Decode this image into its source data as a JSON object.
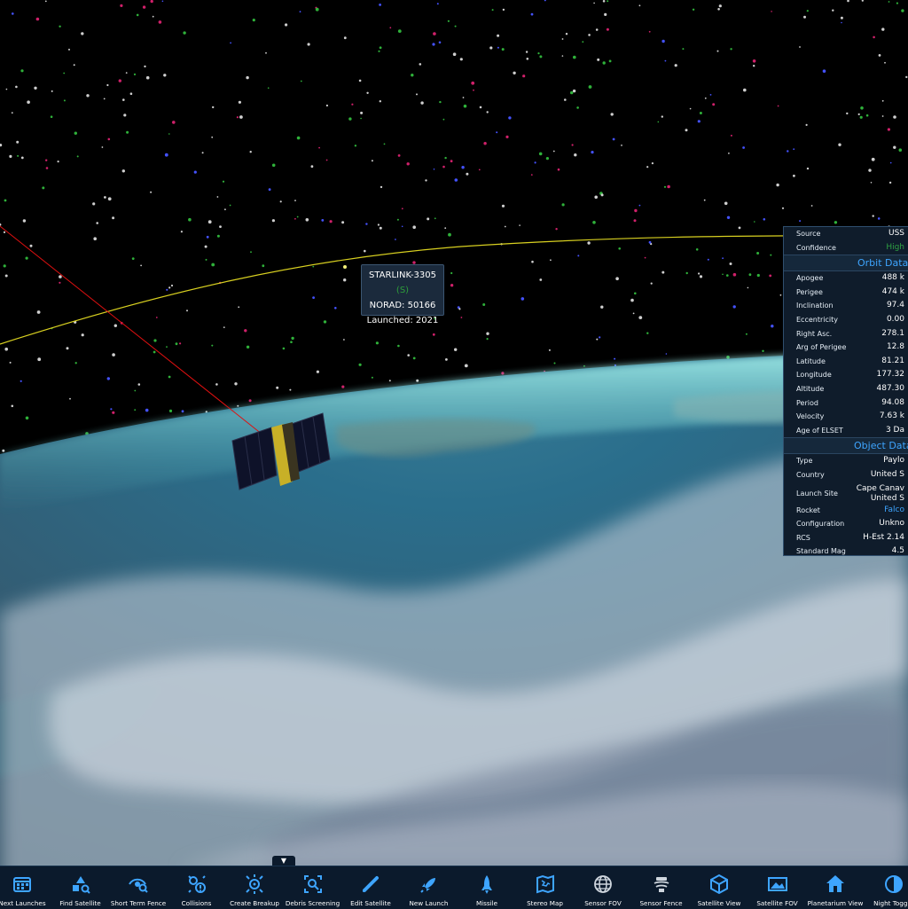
{
  "tooltip": {
    "name": "STARLINK-3305",
    "id_tag": "(S)",
    "norad": "NORAD: 50166",
    "launched": "Launched: 2021"
  },
  "info_panel": {
    "top_rows": [
      {
        "label": "Source",
        "value": "USS"
      },
      {
        "label": "Confidence",
        "value": "High"
      }
    ],
    "orbit_header": "Orbit Data",
    "orbit_rows": [
      {
        "label": "Apogee",
        "value": "488 k"
      },
      {
        "label": "Perigee",
        "value": "474 k"
      },
      {
        "label": "Inclination",
        "value": "97.4"
      },
      {
        "label": "Eccentricity",
        "value": "0.00"
      },
      {
        "label": "Right Asc.",
        "value": "278.1"
      },
      {
        "label": "Arg of Perigee",
        "value": "12.8"
      },
      {
        "label": "Latitude",
        "value": "81.21"
      },
      {
        "label": "Longitude",
        "value": "177.32"
      },
      {
        "label": "Altitude",
        "value": "487.30"
      },
      {
        "label": "Period",
        "value": "94.08"
      },
      {
        "label": "Velocity",
        "value": "7.63 k"
      },
      {
        "label": "Age of ELSET",
        "value": "3 Da"
      }
    ],
    "object_header": "Object Data",
    "object_rows": [
      {
        "label": "Type",
        "value": "Paylo"
      },
      {
        "label": "Country",
        "value": "United S"
      },
      {
        "label": "Launch Site",
        "value": "Cape Canav",
        "value2": "United S"
      },
      {
        "label": "Rocket",
        "value": "Falco"
      },
      {
        "label": "Configuration",
        "value": "Unkno"
      },
      {
        "label": "RCS",
        "value": "H-Est 2.14"
      },
      {
        "label": "Standard Mag",
        "value": "4.5"
      }
    ]
  },
  "dock": {
    "toggle_glyph": "▼",
    "items": [
      {
        "label": "Next Launches",
        "icon": "calendar-icon"
      },
      {
        "label": "Find Satellite",
        "icon": "find-satellite-icon"
      },
      {
        "label": "Short Term Fence",
        "icon": "eye-search-icon"
      },
      {
        "label": "Collisions",
        "icon": "collision-icon"
      },
      {
        "label": "Create Breakup",
        "icon": "breakup-icon"
      },
      {
        "label": "Debris Screening",
        "icon": "debris-search-icon"
      },
      {
        "label": "Edit Satellite",
        "icon": "pencil-icon"
      },
      {
        "label": "New Launch",
        "icon": "rocket-icon"
      },
      {
        "label": "Missile",
        "icon": "missile-icon"
      },
      {
        "label": "Stereo Map",
        "icon": "map-icon"
      },
      {
        "label": "Sensor FOV",
        "icon": "globe-icon"
      },
      {
        "label": "Sensor Fence",
        "icon": "radar-icon"
      },
      {
        "label": "Satellite View",
        "icon": "cube-icon"
      },
      {
        "label": "Satellite FOV",
        "icon": "image-icon"
      },
      {
        "label": "Planetarium View",
        "icon": "house-icon"
      },
      {
        "label": "Night Toggle",
        "icon": "night-icon"
      }
    ]
  },
  "colors": {
    "accent": "#3ea5ff",
    "orbit_line": "#d8d020",
    "los_line": "#e01010",
    "confidence_high": "#2ea043"
  }
}
